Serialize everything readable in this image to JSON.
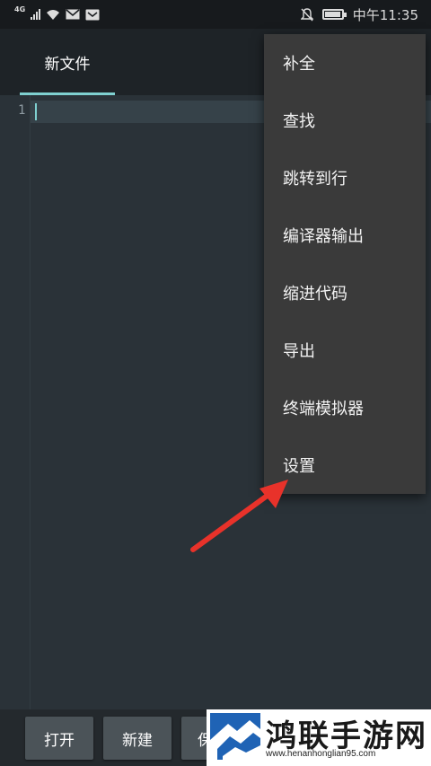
{
  "status_bar": {
    "network": "4G",
    "time": "中午11:35",
    "icons": [
      "signal-icon",
      "wifi-icon",
      "mail-icon",
      "notification-icon",
      "mute-icon",
      "battery-icon"
    ]
  },
  "tabs": [
    {
      "label": "新文件",
      "active": true
    }
  ],
  "editor": {
    "line_numbers": [
      "1"
    ],
    "content": ""
  },
  "menu": {
    "items": [
      "补全",
      "查找",
      "跳转到行",
      "编译器输出",
      "缩进代码",
      "导出",
      "终端模拟器",
      "设置"
    ]
  },
  "bottom_bar": {
    "buttons": [
      "打开",
      "新建",
      "保"
    ]
  },
  "watermark": {
    "title": "鸿联手游网",
    "url": "www.henanhonglian95.com"
  },
  "colors": {
    "accent": "#7fd0d0",
    "arrow": "#e8322a",
    "menu_bg": "#3a3a3a",
    "editor_bg": "#2a3238"
  }
}
